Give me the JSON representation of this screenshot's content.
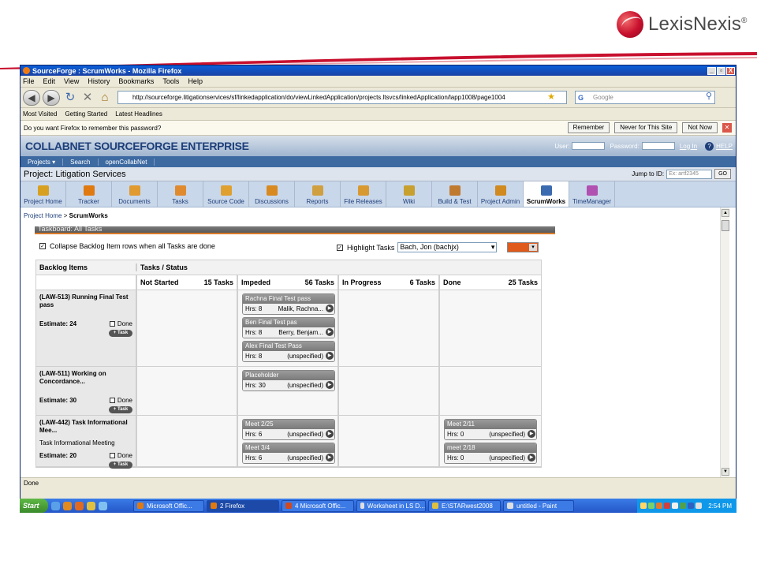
{
  "slide": {
    "brand": "LexisNexis",
    "brand_mark": "®"
  },
  "window": {
    "title": "SourceForge : ScrumWorks - Mozilla Firefox",
    "controls": [
      "_",
      "▫",
      "X"
    ],
    "menu": [
      "File",
      "Edit",
      "View",
      "History",
      "Bookmarks",
      "Tools",
      "Help"
    ],
    "url": "http://sourceforge.litigationservices/sf/linkedapplication/do/viewLinkedApplication/projects.ltsvcs/linkedApplication/lapp1008/page1004",
    "search_engine": "G",
    "search_placeholder": "Google",
    "bookmarks": [
      "Most Visited",
      "Getting Started",
      "Latest Headlines"
    ],
    "notification": {
      "message": "Do you want Firefox to remember this password?",
      "buttons": [
        "Remember",
        "Never for This Site",
        "Not Now"
      ]
    },
    "status": "Done"
  },
  "collabnet": {
    "logo": "COLLABNET SOURCEFORGE ENTERPRISE",
    "user_label": "User:",
    "password_label": "Password:",
    "login": "Log In",
    "help": "HELP",
    "nav": [
      "Projects ▾",
      "Search",
      "openCollabNet"
    ],
    "project_title": "Project: Litigation Services",
    "jump_label": "Jump to ID:",
    "jump_placeholder": "Ex: artf2345",
    "go": "GO",
    "tabs": [
      {
        "label": "Project Home",
        "color": "#d8a020"
      },
      {
        "label": "Tracker",
        "color": "#e07a10"
      },
      {
        "label": "Documents",
        "color": "#e09a30"
      },
      {
        "label": "Tasks",
        "color": "#e08a30"
      },
      {
        "label": "Source Code",
        "color": "#e0a030"
      },
      {
        "label": "Discussions",
        "color": "#d88a20"
      },
      {
        "label": "Reports",
        "color": "#d0a040"
      },
      {
        "label": "File Releases",
        "color": "#d89a30"
      },
      {
        "label": "Wiki",
        "color": "#c8a030"
      },
      {
        "label": "Build & Test",
        "color": "#c07a30"
      },
      {
        "label": "Project Admin",
        "color": "#d08a20"
      },
      {
        "label": "ScrumWorks",
        "color": "#3a6ab0"
      },
      {
        "label": "TimeManager",
        "color": "#b050b0"
      }
    ],
    "breadcrumb": {
      "home": "Project Home",
      "sep": ">",
      "current": "ScrumWorks"
    }
  },
  "taskboard": {
    "title": "Taskboard: All Tasks",
    "collapse_label": "Collapse Backlog Item rows when all Tasks are done",
    "highlight_label": "Highlight Tasks",
    "highlight_user": "Bach, Jon (bachjx)",
    "highlight_color": "#e05a1c",
    "header_backlog": "Backlog Items",
    "header_tasks": "Tasks / Status",
    "columns": [
      {
        "name": "Not Started",
        "count": "15 Tasks"
      },
      {
        "name": "Impeded",
        "count": "56 Tasks"
      },
      {
        "name": "In Progress",
        "count": "6 Tasks"
      },
      {
        "name": "Done",
        "count": "25 Tasks"
      }
    ],
    "done_label": "Done",
    "add_task_label": "+ Task",
    "rows": [
      {
        "title": "(LAW-513) Running Final Test pass",
        "subtitle": "",
        "estimate": "Estimate: 24",
        "cells": [
          [],
          [
            {
              "title": "Rachna Final Test pass",
              "hrs": "Hrs: 8",
              "owner": "Malik, Rachna..."
            },
            {
              "title": "Ben Final Test pas",
              "hrs": "Hrs: 8",
              "owner": "Berry, Benjam..."
            },
            {
              "title": "Alex Final Test Pass",
              "hrs": "Hrs: 8",
              "owner": "(unspecified)"
            }
          ],
          [],
          []
        ]
      },
      {
        "title": "(LAW-511) Working on Concordance...",
        "subtitle": "",
        "estimate": "Estimate: 30",
        "cells": [
          [],
          [
            {
              "title": "Placeholder",
              "hrs": "Hrs: 30",
              "owner": "(unspecified)"
            }
          ],
          [],
          []
        ]
      },
      {
        "title": "(LAW-442) Task Informational Mee...",
        "subtitle": "Task Informational Meeting",
        "estimate": "Estimate: 20",
        "cells": [
          [],
          [
            {
              "title": "Meet 2/25",
              "hrs": "Hrs: 6",
              "owner": "(unspecified)"
            },
            {
              "title": "Meet 3/4",
              "hrs": "Hrs: 6",
              "owner": "(unspecified)"
            }
          ],
          [],
          [
            {
              "title": "Meet 2/11",
              "hrs": "Hrs: 0",
              "owner": "(unspecified)"
            },
            {
              "title": "meet 2/18",
              "hrs": "Hrs: 0",
              "owner": "(unspecified)"
            }
          ]
        ]
      }
    ]
  },
  "taskbar": {
    "start": "Start",
    "buttons": [
      {
        "label": "Microsoft Offic...",
        "color": "#e07a10"
      },
      {
        "label": "2 Firefox",
        "color": "#e07a10",
        "active": true
      },
      {
        "label": "4 Microsoft Offic...",
        "color": "#d04a20"
      },
      {
        "label": "Worksheet in LS D...",
        "color": "#e0e0e0"
      },
      {
        "label": "E:\\STARwest2008",
        "color": "#e0c040"
      },
      {
        "label": "untitled - Paint",
        "color": "#e0e0e0"
      }
    ],
    "clock": "2:54 PM"
  }
}
